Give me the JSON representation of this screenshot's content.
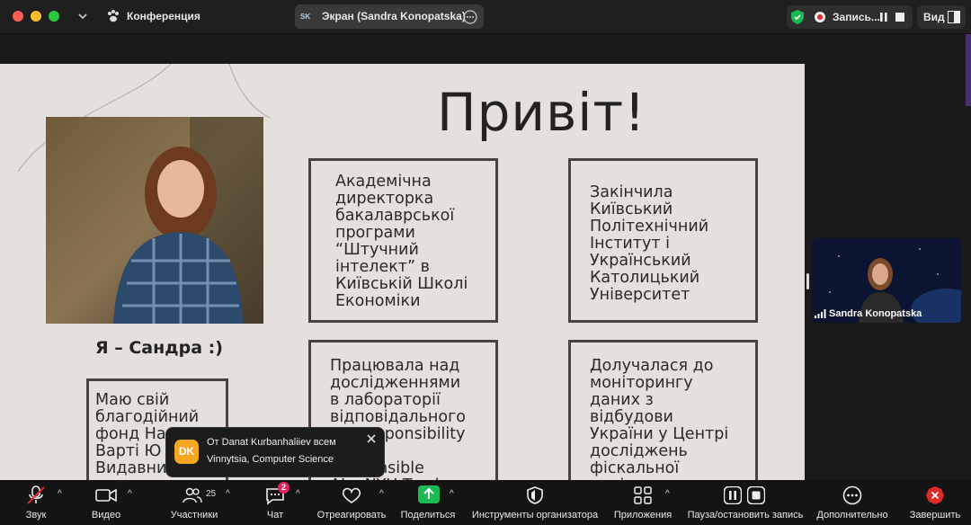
{
  "titlebar": {
    "meeting_name": "Конференция",
    "share_label": "Экран (Sandra Konopatska)",
    "share_avatar": "SK",
    "record_label": "Запись...",
    "view_label": "Вид"
  },
  "slide": {
    "title": "Привіт!",
    "caption": "Я – Сандра :)",
    "box1": "Академічна\nдиректорка\nбакалаврської\nпрограми\n“Штучний\nінтелект” в\nКиївській Школі\nЕкономіки",
    "box2": "Закінчила\nКиївський\nПолітехнічний\nІнститут і\nУкраїнський\nКатолицький\nУніверситет",
    "box3": "Працювала над\nдослідженнями\nв лабораторії\nвідповідального\nШІ Responsibility Center\nResponsible\nAI в NYU Tandon",
    "box4": "Долучалася до\nмоніторингу\nданих з\nвідбудови\nУкраїни у Центрі\nдосліджень\nфіскальної\nполітики",
    "box5": "Маю свій\nблагодійний\nфонд На\nВарті Ю\nВидавни\nzzz"
  },
  "participant": {
    "name": "Sandra Konopatska"
  },
  "toast": {
    "avatar": "DK",
    "from": "От Danat Kurbanhaliiev всем",
    "message": "Vinnytsia, Computer Science"
  },
  "toolbar": {
    "audio": "Звук",
    "video": "Видео",
    "participants": "Участники",
    "participants_count": "25",
    "chat": "Чат",
    "chat_badge": "2",
    "react": "Отреагировать",
    "share": "Поделиться",
    "host_tools": "Инструменты организатора",
    "apps": "Приложения",
    "pause_record": "Пауза/остановить запись",
    "more": "Дополнительно",
    "end": "Завершить"
  },
  "colors": {
    "slide_bg": "#e5e0dc",
    "share_green": "#1db954",
    "end_red": "#e02828",
    "badge": "#e0245e"
  }
}
